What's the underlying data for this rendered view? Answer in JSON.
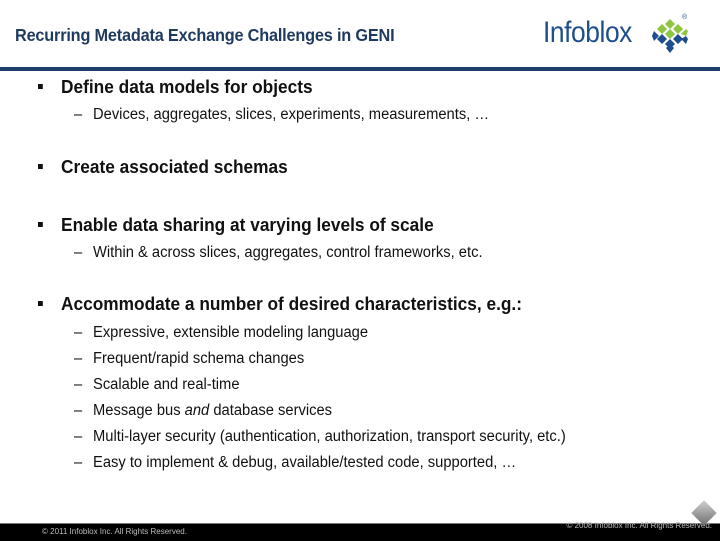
{
  "header": {
    "title": "Recurring Metadata Exchange Challenges in GENI",
    "logo": {
      "text": "Infoblox",
      "registered": "®",
      "icon": "infoblox-diamond-grid-icon",
      "colors": {
        "text": "#1f4e8c",
        "green": "#8dc63f",
        "blue": "#1f4e8c"
      }
    },
    "rule_color": "#1b3f66"
  },
  "bullets": [
    {
      "text": "Define data models for objects",
      "subitems": [
        {
          "text": "Devices, aggregates, slices, experiments, measurements, …"
        }
      ]
    },
    {
      "text": "Create associated schemas",
      "subitems": []
    },
    {
      "text": "Enable data sharing at varying levels of scale",
      "subitems": [
        {
          "text": "Within & across slices, aggregates, control frameworks, etc."
        }
      ]
    },
    {
      "text": "Accommodate a number of desired characteristics, e.g.:",
      "subitems": [
        {
          "text": "Expressive, extensible modeling language"
        },
        {
          "text": "Frequent/rapid schema changes"
        },
        {
          "text": "Scalable and real-time"
        },
        {
          "text_before": "Message bus ",
          "text_em": "and",
          "text_after": " database services"
        },
        {
          "text": "Multi-layer security (authentication, authorization, transport security, etc.)"
        },
        {
          "text": "Easy to implement & debug, available/tested code, supported, …"
        }
      ]
    }
  ],
  "bullet_glyph": "square",
  "dash_glyph": "–",
  "footer": {
    "left": "© 2011 Infoblox Inc. All Rights Reserved.",
    "right": "© 2008 Infoblox Inc. All Rights Reserved."
  }
}
